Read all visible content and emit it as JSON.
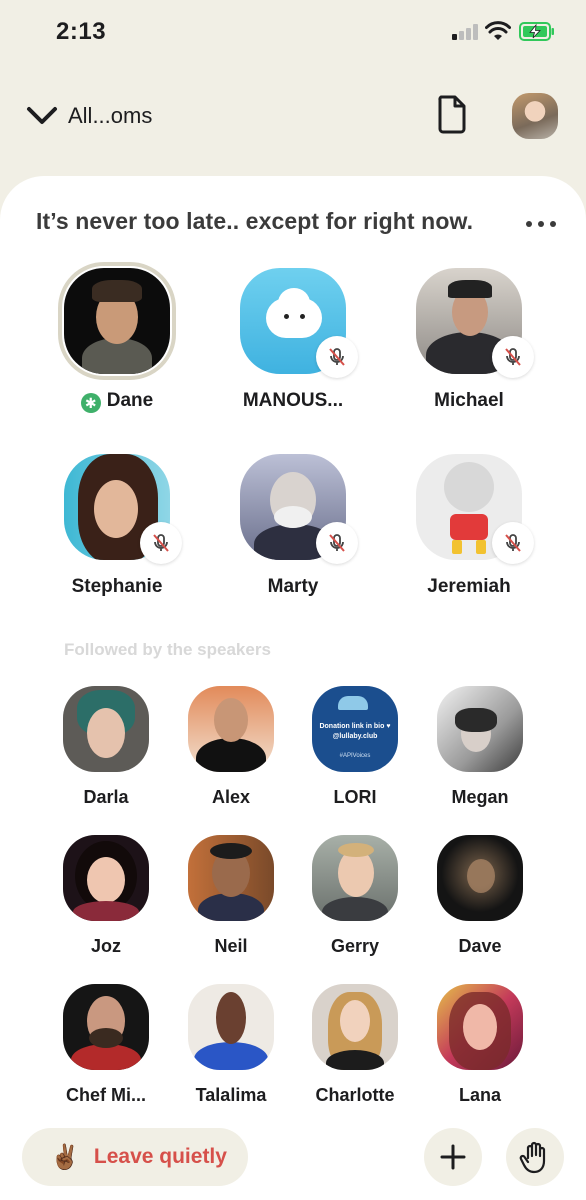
{
  "status_bar": {
    "time": "2:13"
  },
  "header": {
    "back_label": "All...oms"
  },
  "room": {
    "title": "It’s never too late.. except for right now.",
    "speakers": [
      {
        "name": "Dane",
        "moderator": true,
        "muted": false
      },
      {
        "name": "MANOUS...",
        "moderator": false,
        "muted": true
      },
      {
        "name": "Michael",
        "moderator": false,
        "muted": true
      },
      {
        "name": "Stephanie",
        "moderator": false,
        "muted": true
      },
      {
        "name": "Marty",
        "moderator": false,
        "muted": true
      },
      {
        "name": "Jeremiah",
        "moderator": false,
        "muted": true
      }
    ],
    "section_label": "Followed by the speakers",
    "listeners": [
      {
        "name": "Darla"
      },
      {
        "name": "Alex"
      },
      {
        "name": "LORI",
        "avatar_text": [
          "Donation link in bio ♥",
          "@lullaby.club",
          "#APIVoices"
        ]
      },
      {
        "name": "Megan"
      },
      {
        "name": "Joz"
      },
      {
        "name": "Neil"
      },
      {
        "name": "Gerry"
      },
      {
        "name": "Dave"
      },
      {
        "name": "Chef Mi..."
      },
      {
        "name": "Talalima"
      },
      {
        "name": "Charlotte"
      },
      {
        "name": "Lana"
      }
    ]
  },
  "footer": {
    "leave_emoji": "✌🏾",
    "leave_label": "Leave quietly"
  },
  "colors": {
    "background": "#f1efe5",
    "leave_text": "#d6504a",
    "moderator_badge": "#3fb06a",
    "battery": "#31c85a"
  },
  "icons": [
    "chevron-down-icon",
    "document-icon",
    "more-icon",
    "microphone-muted-icon",
    "plus-icon",
    "raise-hand-icon",
    "cellular-signal-icon",
    "wifi-icon",
    "battery-charging-icon"
  ]
}
